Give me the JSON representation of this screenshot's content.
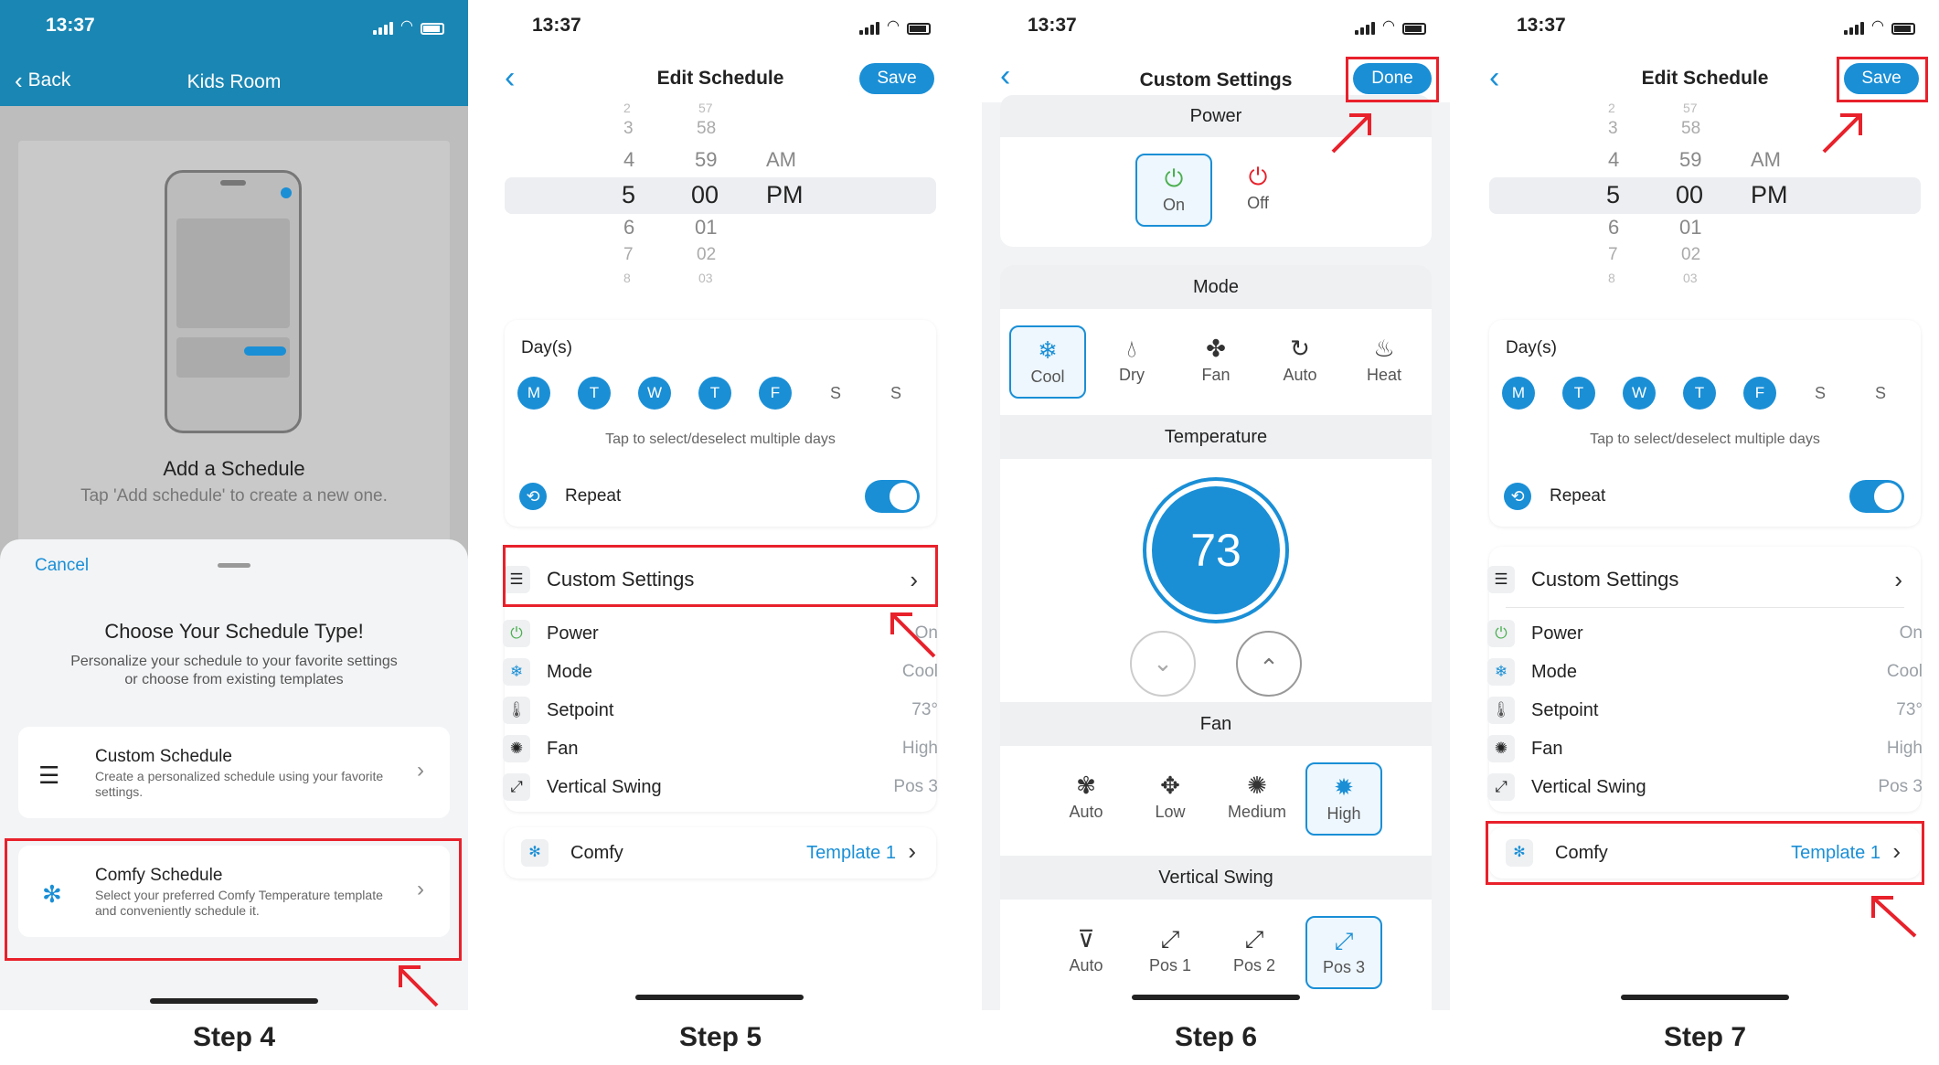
{
  "status": {
    "time": "13:37"
  },
  "steps": [
    "Step 4",
    "Step 5",
    "Step 6",
    "Step 7"
  ],
  "p4": {
    "back": "Back",
    "title": "Kids Room",
    "empty_title": "Add a Schedule",
    "empty_sub": "Tap 'Add schedule' to create a new one.",
    "sheet": {
      "cancel": "Cancel",
      "title": "Choose Your Schedule Type!",
      "subtitle": "Personalize your schedule to your favorite settings or choose from existing templates",
      "options": [
        {
          "title": "Custom Schedule",
          "desc": "Create a personalized schedule using your favorite settings."
        },
        {
          "title": "Comfy Schedule",
          "desc": "Select your preferred Comfy Temperature template and conveniently schedule it."
        }
      ]
    }
  },
  "edit": {
    "title": "Edit Schedule",
    "save": "Save",
    "hours": [
      "2",
      "3",
      "4",
      "5",
      "6",
      "7",
      "8"
    ],
    "minutes": [
      "57",
      "58",
      "59",
      "00",
      "01",
      "02",
      "03"
    ],
    "ampm": [
      "AM",
      "PM"
    ],
    "days_label": "Day(s)",
    "days": [
      {
        "l": "M",
        "on": true
      },
      {
        "l": "T",
        "on": true
      },
      {
        "l": "W",
        "on": true
      },
      {
        "l": "T",
        "on": true
      },
      {
        "l": "F",
        "on": true
      },
      {
        "l": "S",
        "on": false
      },
      {
        "l": "S",
        "on": false
      }
    ],
    "days_hint": "Tap to select/deselect multiple days",
    "repeat": "Repeat",
    "custom_settings": "Custom Settings",
    "settings": [
      {
        "label": "Power",
        "value": "On",
        "icon": "power-icon",
        "glyph": "⏻",
        "color": "#4caf50"
      },
      {
        "label": "Mode",
        "value": "Cool",
        "icon": "snowflake-icon",
        "glyph": "❄",
        "color": "#1a8fd6"
      },
      {
        "label": "Setpoint",
        "value": "73°",
        "icon": "thermometer-icon",
        "glyph": "🌡",
        "color": "#555"
      },
      {
        "label": "Fan",
        "value": "High",
        "icon": "fan-icon",
        "glyph": "✺",
        "color": "#222"
      },
      {
        "label": "Vertical Swing",
        "value": "Pos 3",
        "icon": "swing-icon",
        "glyph": "⤢",
        "color": "#222"
      }
    ],
    "comfy": "Comfy",
    "template": "Template 1"
  },
  "p6": {
    "title": "Custom Settings",
    "done": "Done",
    "power_title": "Power",
    "power_on": "On",
    "power_off": "Off",
    "mode_title": "Mode",
    "modes": [
      "Cool",
      "Dry",
      "Fan",
      "Auto",
      "Heat"
    ],
    "temp_title": "Temperature",
    "temp": "73",
    "fan_title": "Fan",
    "fans": [
      "Auto",
      "Low",
      "Medium",
      "High"
    ],
    "swing_title": "Vertical Swing",
    "swings": [
      "Auto",
      "Pos 1",
      "Pos 2",
      "Pos 3"
    ]
  },
  "colors": {
    "accent": "#1a8fd6",
    "highlight": "#e8212b",
    "header": "#1a8bb8"
  }
}
